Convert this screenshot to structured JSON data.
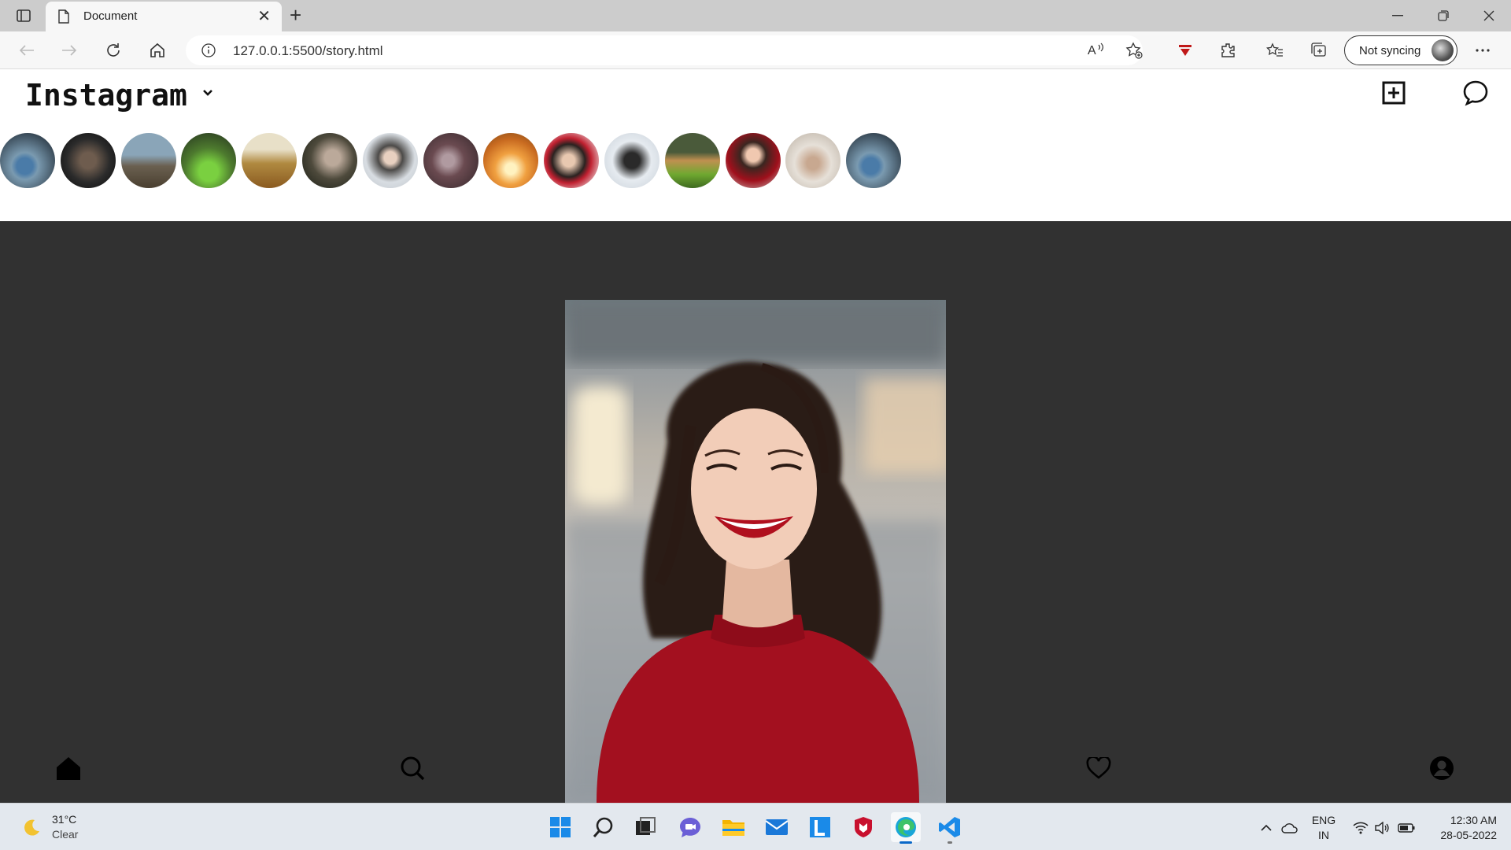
{
  "browser": {
    "tab_title": "Document",
    "url": "127.0.0.1:5500/story.html",
    "sync_label": "Not syncing"
  },
  "app": {
    "logo": "Instagram",
    "stories_count": 15,
    "bottom_nav": [
      "home-icon",
      "search-icon",
      "heart-icon",
      "profile-icon"
    ],
    "viewer_background": "#313131",
    "story_subject_color": "#a3101f"
  },
  "taskbar": {
    "weather_temp": "31°C",
    "weather_condition": "Clear",
    "lang_line1": "ENG",
    "lang_line2": "IN",
    "time": "12:30 AM",
    "date": "28-05-2022",
    "pinned_apps": [
      "start",
      "search",
      "task-view",
      "teams-chat",
      "file-explorer",
      "mail",
      "l-app",
      "mcafee",
      "edge",
      "vscode"
    ]
  }
}
